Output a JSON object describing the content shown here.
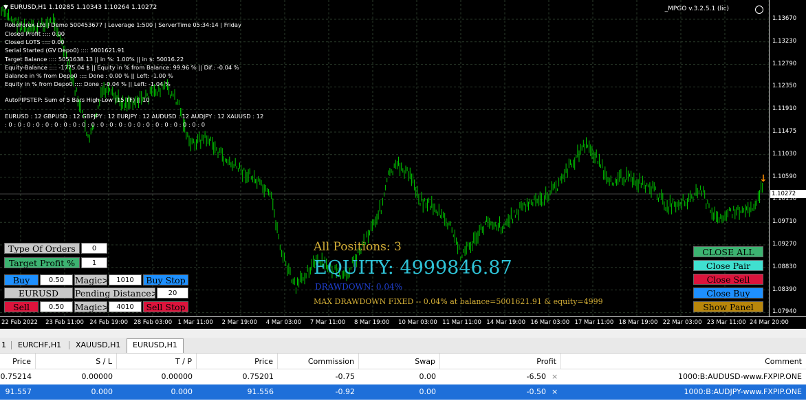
{
  "chart": {
    "header": "▼  EURUSD,H1  1.10285 1.10343 1.10264 1.10272",
    "expert_name": "_MPGO v.3.2.5.1 (lic)",
    "current_price": "1.10272",
    "price_ticks": [
      "1.13670",
      "1.13230",
      "1.12790",
      "1.12350",
      "1.11910",
      "1.11475",
      "1.11030",
      "1.10590",
      "1.10150",
      "1.09710",
      "1.09270",
      "1.08830",
      "1.08390",
      "1.07940"
    ],
    "time_ticks": [
      "22 Feb 2022",
      "23 Feb 11:00",
      "24 Feb 19:00",
      "28 Feb 03:00",
      "1 Mar 11:00",
      "2 Mar 19:00",
      "4 Mar 03:00",
      "7 Mar 11:00",
      "8 Mar 19:00",
      "10 Mar 03:00",
      "11 Mar 11:00",
      "14 Mar 19:00",
      "16 Mar 03:00",
      "17 Mar 11:00",
      "18 Mar 19:00",
      "22 Mar 03:00",
      "23 Mar 11:00",
      "24 Mar 20:00"
    ],
    "info_lines": [
      "RoboForex Ltd  |  Demo  500453677  |  Leverage 1:500  |  ServerTime 05:34:14  |  Friday",
      "Closed Profit   ::::  0.00",
      "Closed LOTS    ::::  0.00",
      "Serial Started (GV Depo0)   ::::  5001621.91",
      "Target Balance   ::::  5051638.13  ||  in %: 1.00%   ||  in $: 50016.22",
      "Equity-Balance   ::::  -1775.04 $  ||  Equity in % from Balance: 99.96 %  ||  Dif.: -0.04 %",
      "Balance in % from Depo0 ::::  Done : 0.00 %  ||  Left: -1.00 %",
      "Equity   in % from Depo0 ::::  Done : -0.04 %  ||  Left: -1.04 %",
      "AutoPIPSTEP: Sum of 5 Bars High-Low (15 TF)   ||   10",
      "EURUSD : 12      GBPUSD : 12      GBPJPY : 12      EURJPY : 12      AUDUSD : 12      AUDJPY : 12      XAUUSD : 12",
      " : 0      : 0      : 0      : 0      : 0      : 0      : 0      : 0      : 0      : 0      : 0      : 0      : 0      : 0      : 0      : 0      : 0      : 0      : 0      : 0      : 0      : 0"
    ],
    "overlay": {
      "all_positions": "All Positions:  3",
      "equity": "EQUITY:  4999846.87",
      "drawdown": "DRAWDOWN: 0.04%",
      "max_drawdown": "MAX DRAWDOWN FIXED -- 0.04% at balance=5001621.91 & equity=4999"
    },
    "colors": {
      "candle": "#00c800",
      "grid": "#2a3a2a",
      "bg": "#000000",
      "accent": "#d4af37",
      "equity": "#2fc4d8"
    }
  },
  "panel": {
    "type_of_orders": "Type Of Orders",
    "type_value": "0",
    "target_profit": "Target Profit %",
    "target_value": "1",
    "buy": "Buy",
    "buy_lot": "0.50",
    "magic_buy": "Magic>",
    "magic_buy_value": "1010",
    "buy_stop": "Buy Stop",
    "symbol": "EURUSD",
    "pending_distance": "Pending Distance>",
    "pending_value": "20",
    "sell": "Sell",
    "sell_lot": "0.50",
    "magic_sell": "Magic>",
    "magic_sell_value": "4010",
    "sell_stop": "Sell Stop"
  },
  "right_panel": {
    "close_all": "CLOSE ALL",
    "close_pair": "Close Pair",
    "close_sell": "Close Sell",
    "close_buy": "Close Buy",
    "show_panel": "Show Panel"
  },
  "tabs": {
    "first": "1",
    "items": [
      "EURCHF,H1",
      "XAUUSD,H1",
      "EURUSD,H1"
    ],
    "active": "EURUSD,H1"
  },
  "table": {
    "headers": [
      "Price",
      "S / L",
      "T / P",
      "Price",
      "Commission",
      "Swap",
      "Profit",
      "Comment"
    ],
    "rows": [
      [
        "0.75214",
        "0.00000",
        "0.00000",
        "0.75201",
        "-0.75",
        "0.00",
        "-6.50",
        "1000:B:AUDUSD-www.FXPIP.ONE"
      ],
      [
        "91.557",
        "0.000",
        "0.000",
        "91.556",
        "-0.92",
        "0.00",
        "-0.50",
        "1000:B:AUDJPY-www.FXPIP.ONE"
      ]
    ],
    "close_glyph": "×"
  }
}
